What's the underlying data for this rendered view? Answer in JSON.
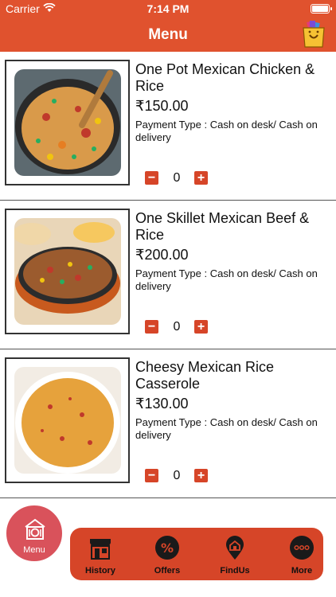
{
  "status_bar": {
    "carrier": "Carrier",
    "time": "7:14 PM"
  },
  "header": {
    "title": "Menu"
  },
  "menu_items": [
    {
      "name": "One Pot Mexican Chicken & Rice",
      "price": "₹150.00",
      "payment": "Payment Type : Cash on desk/ Cash on delivery",
      "quantity": "0",
      "minus": "−",
      "plus": "+"
    },
    {
      "name": "One Skillet Mexican Beef & Rice",
      "price": "₹200.00",
      "payment": "Payment Type : Cash on desk/ Cash on delivery",
      "quantity": "0",
      "minus": "−",
      "plus": "+"
    },
    {
      "name": "Cheesy Mexican Rice Casserole",
      "price": "₹130.00",
      "payment": "Payment Type : Cash on desk/ Cash on delivery",
      "quantity": "0",
      "minus": "−",
      "plus": "+"
    }
  ],
  "tabs": {
    "menu": "Menu",
    "history": "History",
    "offers": "Offers",
    "findus": "FindUs",
    "more": "More"
  },
  "colors": {
    "accent": "#e0522e",
    "tabbar": "#d64528",
    "menu_fab": "#d9525b"
  }
}
